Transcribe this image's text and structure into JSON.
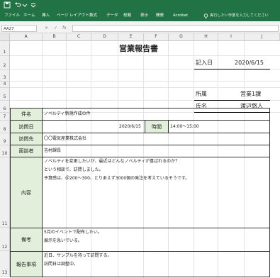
{
  "ribbon": {
    "tabs": [
      "ファイル",
      "ホーム",
      "挿入",
      "ページ レイアウト",
      "数式",
      "データ",
      "校閲",
      "表示",
      "開発",
      "Acrobat"
    ],
    "tellme": "実行したい作業を入力してください"
  },
  "formula_bar": {
    "namebox": "AA27",
    "cancel": "×",
    "enter": "✓",
    "fx": "fx"
  },
  "columns": [
    "A",
    "B",
    "C",
    "D",
    "E",
    "F",
    "G",
    "H",
    "I",
    "J"
  ],
  "rows": [
    "1",
    "2",
    "3",
    "4",
    "5",
    "6",
    "7",
    "8",
    "9",
    "10",
    "11",
    "12",
    "13"
  ],
  "report": {
    "title": "営業報告書",
    "date_label": "記入日",
    "date_value": "2020/6/15",
    "dept_label": "所属",
    "dept_value": "営業1課",
    "name_label": "氏名",
    "name_value": "渡辺悠人",
    "subject_label": "件名",
    "subject_value": "ノベルティ新規作成の件",
    "visit_date_label": "訪問日",
    "visit_date_value": "2020/6/15",
    "time_label": "時間",
    "time_value": "14:00～15:00",
    "visit_to_label": "訪問先",
    "visit_to_value": "〇〇電気産業株式会社",
    "interviewer_label": "面談者",
    "interviewer_value": "吉村課長",
    "content_label": "内容",
    "content_lines": [
      "ノベルティを変更したいが、最近はどんなノベルティが喜ばれるのか？",
      "という相談で、訪問しました。",
      "予算感は、＠200～300、とりあえず3000個の発注を考えているそうです。"
    ],
    "notes_label": "備考",
    "notes_lines": [
      "5月のイベントで配布したい。",
      "展示を急いでいる。"
    ],
    "report_label": "報告事項",
    "report_lines": [
      "近日、サンプルを持って訪問する。",
      "訪問日は調整中。"
    ]
  }
}
